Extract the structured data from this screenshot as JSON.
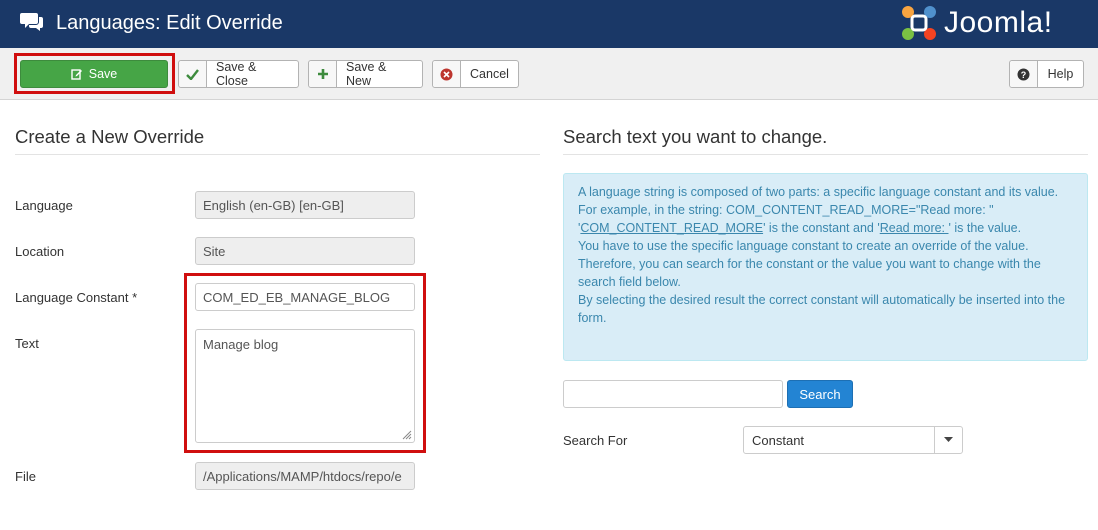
{
  "header": {
    "title": "Languages: Edit Override",
    "title_icon": "comments-icon",
    "brand": {
      "name": "Joomla!",
      "name_main": "Joomla!",
      "reg": "®"
    }
  },
  "toolbar": {
    "save_label": "Save",
    "save_close_label": "Save & Close",
    "save_new_label": "Save & New",
    "cancel_label": "Cancel",
    "help_label": "Help"
  },
  "form": {
    "heading": "Create a New Override",
    "fields": {
      "language": {
        "label": "Language",
        "value": "English (en-GB) [en-GB]"
      },
      "location": {
        "label": "Location",
        "value": "Site"
      },
      "constant": {
        "label": "Language Constant *",
        "value": "COM_ED_EB_MANAGE_BLOG"
      },
      "text": {
        "label": "Text",
        "value": "Manage blog"
      },
      "file": {
        "label": "File",
        "value": "/Applications/MAMP/htdocs/repo/e"
      }
    }
  },
  "search": {
    "heading": "Search text you want to change.",
    "info": {
      "line1": "A language string is composed of two parts: a specific language constant and its value.",
      "line2a": "For example, in the string: COM_CONTENT_READ_MORE=\"Read more: \"",
      "line3_q1": "'",
      "line3_constant": "COM_CONTENT_READ_MORE",
      "line3_mid": "' is the constant and '",
      "line3_value": "Read more: ",
      "line3_end": "' is the value.",
      "line4": "You have to use the specific language constant to create an override of the value.",
      "line5": "Therefore, you can search for the constant or the value you want to change with the search field below.",
      "line6": "By selecting the desired result the correct constant will automatically be inserted into the form."
    },
    "input_value": "",
    "button_label": "Search",
    "search_for_label": "Search For",
    "search_for_value": "Constant"
  },
  "colors": {
    "header_bg": "#1a3867",
    "save_green": "#46a546",
    "highlight_red": "#d00e0e",
    "search_blue": "#2384d3",
    "info_bg": "#d9edf7"
  }
}
